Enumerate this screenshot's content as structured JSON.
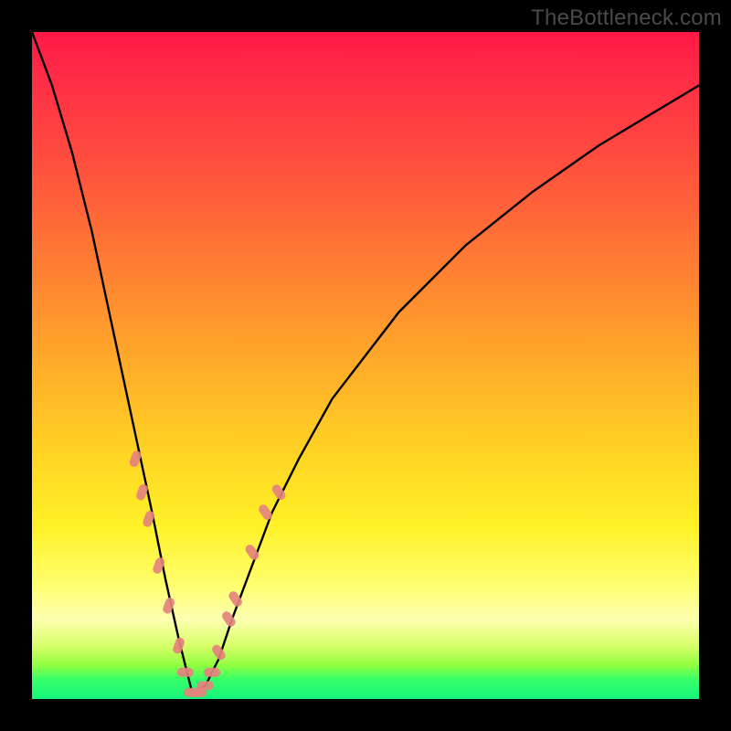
{
  "watermark": "TheBottleneck.com",
  "colors": {
    "frame": "#000000",
    "curve": "#000000",
    "markers": "#e4837e",
    "gradient_stops": [
      "#ff1946",
      "#ff7a33",
      "#ffd024",
      "#fdffb0",
      "#39ff6a",
      "#14f47a"
    ]
  },
  "chart_data": {
    "type": "line",
    "title": "",
    "xlabel": "",
    "ylabel": "",
    "xlim": [
      0,
      100
    ],
    "ylim": [
      0,
      100
    ],
    "grid": false,
    "legend": false,
    "curve_description": "V-shaped bottleneck curve: steep descent from upper-left to a minimum around x≈24, then gradual rise toward upper-right; background gradient red→orange→yellow→green encodes y as optimality (green = best / lowest)",
    "x": [
      0,
      3,
      6,
      9,
      12,
      15,
      18,
      20,
      22,
      24,
      26,
      28,
      30,
      33,
      36,
      40,
      45,
      55,
      65,
      75,
      85,
      95,
      100
    ],
    "y": [
      100,
      92,
      82,
      70,
      56,
      42,
      28,
      18,
      9,
      1,
      2,
      6,
      12,
      20,
      28,
      36,
      45,
      58,
      68,
      76,
      83,
      89,
      92
    ],
    "markers": [
      {
        "x": 15.5,
        "y": 36
      },
      {
        "x": 16.5,
        "y": 31
      },
      {
        "x": 17.5,
        "y": 27
      },
      {
        "x": 19,
        "y": 20
      },
      {
        "x": 20.5,
        "y": 14
      },
      {
        "x": 22,
        "y": 8
      },
      {
        "x": 23,
        "y": 4
      },
      {
        "x": 24,
        "y": 1
      },
      {
        "x": 25,
        "y": 1
      },
      {
        "x": 26,
        "y": 2
      },
      {
        "x": 27,
        "y": 4
      },
      {
        "x": 28,
        "y": 7
      },
      {
        "x": 29.5,
        "y": 12
      },
      {
        "x": 30.5,
        "y": 15
      },
      {
        "x": 33,
        "y": 22
      },
      {
        "x": 35,
        "y": 28
      },
      {
        "x": 37,
        "y": 31
      }
    ]
  }
}
